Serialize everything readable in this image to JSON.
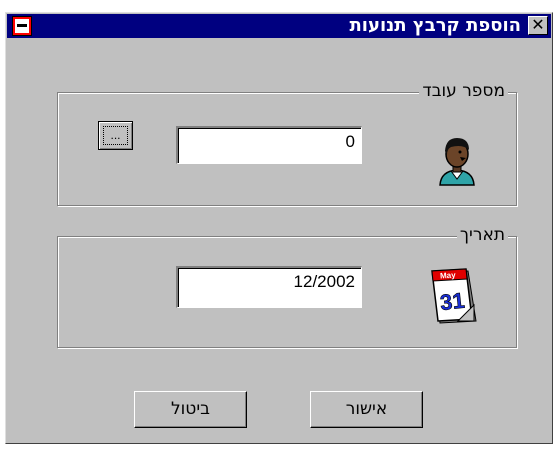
{
  "window": {
    "title": "הוספת קרבץ תנועות",
    "close_glyph": "✕"
  },
  "employee_group": {
    "label": "מספר עובד",
    "value": "0",
    "browse_label": "..."
  },
  "date_group": {
    "label": "תאריך",
    "value": "12/2002",
    "calendar_month": "May",
    "calendar_day": "31"
  },
  "buttons": {
    "ok_label": "אישור",
    "cancel_label": "ביטול"
  },
  "colors": {
    "titlebar": "#000080",
    "dialog": "#c0c0c0",
    "system_button": "#ff0000"
  },
  "icons": {
    "employee": "person-icon",
    "date": "calendar-icon"
  }
}
